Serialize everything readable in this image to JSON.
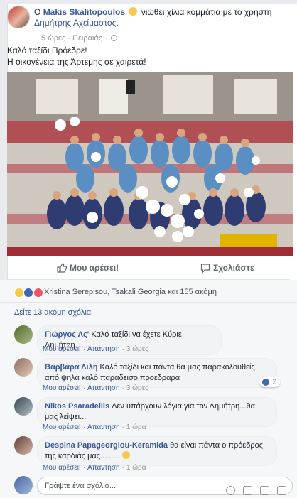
{
  "post": {
    "author": "Makis Skalitopoulos",
    "feeling_prefix": "O",
    "feeling_text": "νιώθει χίλια κομμάτια με το χρήστη",
    "tagged": "Δημήτρης Αχείμαστος",
    "time": "5 ώρες",
    "location": "Πειραιάς",
    "text_line1": "Καλό ταξίδι Πρόεδρε!",
    "text_line2": "Η οικογένεια της Άρτεμης σε χαιρετά!"
  },
  "actions": {
    "like_label": "Μου αρέσει!",
    "comment_label": "Σχολιάστε"
  },
  "reactions": {
    "summary": "Xristina Serepisou, Tsakali Georgia και 155 ακόμη"
  },
  "comments_section": {
    "more_link": "Δείτε 13 ακόμη σχόλια",
    "items": [
      {
        "author": "Γιώργος Λς'",
        "text": "Καλό ταξίδι να έχετε Κύριε Δημήτρη....",
        "like": "Μου αρέσει!",
        "reply": "Απάντηση",
        "time": "3 ώρες"
      },
      {
        "author": "Βαρβαρα Λιλη",
        "text": "Καλό ταξίδι και πάντα θα μας παρακολουθείς από ψηλά καλό παραδεισο προεδραρα",
        "like": "Μου αρέσει!",
        "reply": "Απάντηση",
        "time": "3 ώρες",
        "like_count": "2"
      },
      {
        "author": "Nikos Psaradellis",
        "text": "Δεν υπάρχουν λόγια για τον Δημήτρη...θα μας λείψει...",
        "like": "Μου αρέσει!",
        "reply": "Απάντηση",
        "time": "1 ώρα"
      },
      {
        "author": "Despina Papageorgiou-Keramida",
        "text": "θα είναι πάντα ο πρόεδρος της καρδιάς μας.........",
        "like": "Μου αρέσει!",
        "reply": "Απάντηση",
        "time": "1 ώρα"
      }
    ],
    "reply_placeholder": "Γράψτε ένα σχόλιο..."
  },
  "colors": {
    "link": "#385898",
    "meta": "#90949c",
    "like_blue": "#4267b2",
    "love_red": "#f25268",
    "sad_yellow": "#f7c948"
  }
}
